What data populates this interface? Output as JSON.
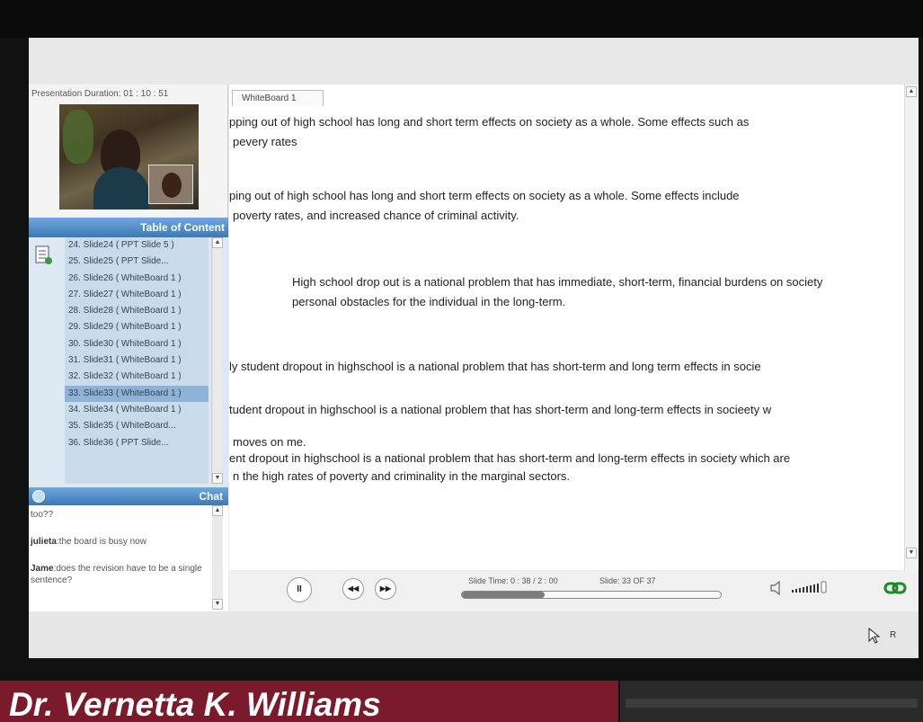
{
  "presentation": {
    "duration_label": "Presentation Duration:",
    "duration_value": "01 : 10 : 51"
  },
  "toc": {
    "title": "Table of Content",
    "items": [
      {
        "label": "24. Slide24 ( PPT Slide 5 )"
      },
      {
        "label": "25. Slide25 ( PPT Slide..."
      },
      {
        "label": "26. Slide26 ( WhiteBoard 1 )"
      },
      {
        "label": "27. Slide27 ( WhiteBoard 1 )"
      },
      {
        "label": "28. Slide28 ( WhiteBoard 1 )"
      },
      {
        "label": "29. Slide29 ( WhiteBoard 1 )"
      },
      {
        "label": "30. Slide30 ( WhiteBoard 1 )"
      },
      {
        "label": "31. Slide31 ( WhiteBoard 1 )"
      },
      {
        "label": "32. Slide32 ( WhiteBoard 1 )"
      },
      {
        "label": "33. Slide33 ( WhiteBoard 1 )",
        "selected": true
      },
      {
        "label": "34. Slide34 ( WhiteBoard 1 )"
      },
      {
        "label": "35. Slide35 ( WhiteBoard..."
      },
      {
        "label": "36. Slide36 ( PPT Slide..."
      }
    ]
  },
  "chat": {
    "title": "Chat",
    "messages": [
      {
        "author": "",
        "text": "too??"
      },
      {
        "author": "julieta",
        "text": ":the board is busy now"
      },
      {
        "author": "Jame",
        "text": ":does the revision have to be a single sentence?"
      }
    ]
  },
  "whiteboard": {
    "tab_label": "WhiteBoard 1",
    "lines": [
      "pping out of high school has long and short term effects on society as a whole. Some effects such as",
      "pevery rates",
      "ping out of high school has long and short term effects on society as a whole. Some effects include",
      "poverty rates, and increased chance of criminal activity.",
      "High school drop out is a national problem that has immediate, short-term, financial burdens on society",
      "personal obstacles for the individual in the long-term.",
      "ly student dropout in highschool is a national problem that has short-term and long term effects in socie",
      "tudent dropout in highschool is a national problem that has short-term and long-term effects in socieety w",
      "moves on me.",
      "ent dropout in highschool is a national problem that has short-term and long-term effects in society which are",
      "n the high rates of poverty and criminality in the marginal sectors."
    ]
  },
  "player": {
    "pause_symbol": "II",
    "prev_symbol": "◀◀",
    "next_symbol": "▶▶",
    "slide_time_label": "Slide Time:",
    "slide_time_value": "0 : 38 / 2 : 00",
    "slide_label": "Slide:",
    "slide_value": "33 OF 37",
    "progress": 0.32
  },
  "footer": {
    "r_label": "R",
    "presenter_name": "Dr. Vernetta K. Williams"
  },
  "colors": {
    "accent_blue": "#3b78b5",
    "name_bar": "#7a1a2a",
    "link_icon": "#1a8a2a"
  }
}
